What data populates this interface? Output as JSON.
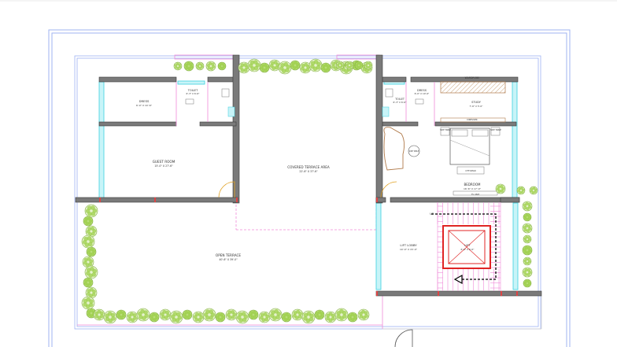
{
  "rooms": {
    "guest_room": {
      "name": "GUEST ROOM",
      "dims": "15'-0\" X 27'-6\""
    },
    "dress_left": {
      "name": "DRESS",
      "dims": "6'-0\" X 10'-6\""
    },
    "toilet_left": {
      "name": "TOILET",
      "dims": "6'-3\" X 6'-6\""
    },
    "covered_terrace": {
      "name": "COVERED TERRACE AREA",
      "dims": "22'-6\" X 37'-6\""
    },
    "dress_right": {
      "name": "DRESS",
      "dims": "6'-0\" X 10'-6\""
    },
    "toilet_right": {
      "name": "TOILET",
      "dims": "6'-3\" X 6'-6\""
    },
    "wardrobe": {
      "name": "WARDROBE"
    },
    "study": {
      "name": "STUDY",
      "dims": "7'-6\" X 5'-0\""
    },
    "dresser": {
      "name": "DRESSER"
    },
    "bedroom": {
      "name": "BEDROOM",
      "dims": "16'-6\" X 17'-9\""
    },
    "open_terrace": {
      "name": "OPEN TERRACE",
      "dims": "40'-6\" X 39'-0\""
    },
    "lift_lobby": {
      "name": "LIFT LOBBY",
      "dims": "10'-0\" X 15'-0\""
    },
    "lift": {
      "name": "LIFT",
      "dims": "6'-6\" X 6'-0\""
    }
  },
  "furniture": {
    "side_table_left": "SIDE TABLE",
    "side_table_right": "SIDE TABLE",
    "ottoman": "OTTOMAN",
    "tv_unit": "TV UNIT",
    "side_table_round": "SIDE TABLE"
  },
  "stair": {
    "up_label": "UP"
  },
  "colors": {
    "wall": "#7a7a7a",
    "wall_edge": "#3a3a3a",
    "glazing": "#7fe3ef",
    "border": "#9fb3f2",
    "dim_line": "#f08ad8",
    "planting": "#9ccf4a",
    "lift_red": "#e02424",
    "arrow": "#000000"
  }
}
